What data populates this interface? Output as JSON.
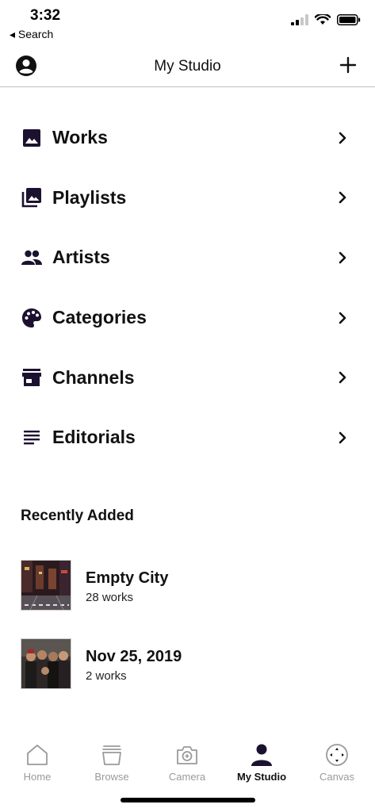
{
  "status_bar": {
    "time": "3:32",
    "back_label": "◂ Search"
  },
  "nav": {
    "title": "My Studio"
  },
  "menu": [
    {
      "icon": "image-icon",
      "label": "Works"
    },
    {
      "icon": "playlist-icon",
      "label": "Playlists"
    },
    {
      "icon": "people-icon",
      "label": "Artists"
    },
    {
      "icon": "palette-icon",
      "label": "Categories"
    },
    {
      "icon": "store-icon",
      "label": "Channels"
    },
    {
      "icon": "text-lines-icon",
      "label": "Editorials"
    }
  ],
  "recently_added": {
    "title": "Recently Added",
    "items": [
      {
        "title": "Empty City",
        "subtitle": "28 works"
      },
      {
        "title": "Nov 25, 2019",
        "subtitle": "2 works"
      }
    ]
  },
  "tabs": [
    {
      "label": "Home",
      "icon": "home-icon",
      "active": false
    },
    {
      "label": "Browse",
      "icon": "browse-icon",
      "active": false
    },
    {
      "label": "Camera",
      "icon": "camera-icon",
      "active": false
    },
    {
      "label": "My Studio",
      "icon": "person-icon",
      "active": true
    },
    {
      "label": "Canvas",
      "icon": "canvas-icon",
      "active": false
    }
  ],
  "colors": {
    "icon_dark": "#1c1230",
    "tab_inactive": "#9a9a9a"
  }
}
